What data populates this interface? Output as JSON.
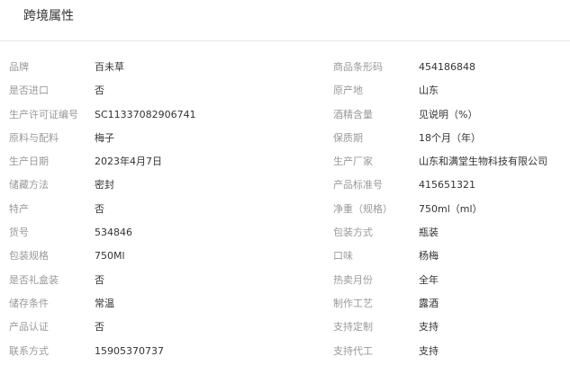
{
  "header": {
    "title": "跨境属性"
  },
  "rows": [
    [
      {
        "label": "品牌",
        "value": "百未草"
      },
      {
        "label": "商品条形码",
        "value": "454186848"
      }
    ],
    [
      {
        "label": "是否进口",
        "value": "否"
      },
      {
        "label": "原产地",
        "value": "山东"
      }
    ],
    [
      {
        "label": "生产许可证编号",
        "value": "SC11337082906741"
      },
      {
        "label": "酒精含量",
        "value": "见说明（%）"
      }
    ],
    [
      {
        "label": "原料与配料",
        "value": "梅子"
      },
      {
        "label": "保质期",
        "value": "18个月（年）"
      }
    ],
    [
      {
        "label": "生产日期",
        "value": "2023年4月7日"
      },
      {
        "label": "生产厂家",
        "value": "山东和满堂生物科技有限公司"
      }
    ],
    [
      {
        "label": "储藏方法",
        "value": "密封"
      },
      {
        "label": "产品标准号",
        "value": "415651321"
      }
    ],
    [
      {
        "label": "特产",
        "value": "否"
      },
      {
        "label": "净重（规格）",
        "value": "750ml（ml）"
      }
    ],
    [
      {
        "label": "货号",
        "value": "534846"
      },
      {
        "label": "包装方式",
        "value": "瓶装"
      }
    ],
    [
      {
        "label": "包装规格",
        "value": "750Ml"
      },
      {
        "label": "口味",
        "value": "杨梅"
      }
    ],
    [
      {
        "label": "是否礼盒装",
        "value": "否"
      },
      {
        "label": "热卖月份",
        "value": "全年"
      }
    ],
    [
      {
        "label": "储存条件",
        "value": "常温"
      },
      {
        "label": "制作工艺",
        "value": "露酒"
      }
    ],
    [
      {
        "label": "产品认证",
        "value": "否"
      },
      {
        "label": "支持定制",
        "value": "支持"
      }
    ],
    [
      {
        "label": "联系方式",
        "value": "15905370737"
      },
      {
        "label": "支持代工",
        "value": "支持"
      }
    ]
  ]
}
